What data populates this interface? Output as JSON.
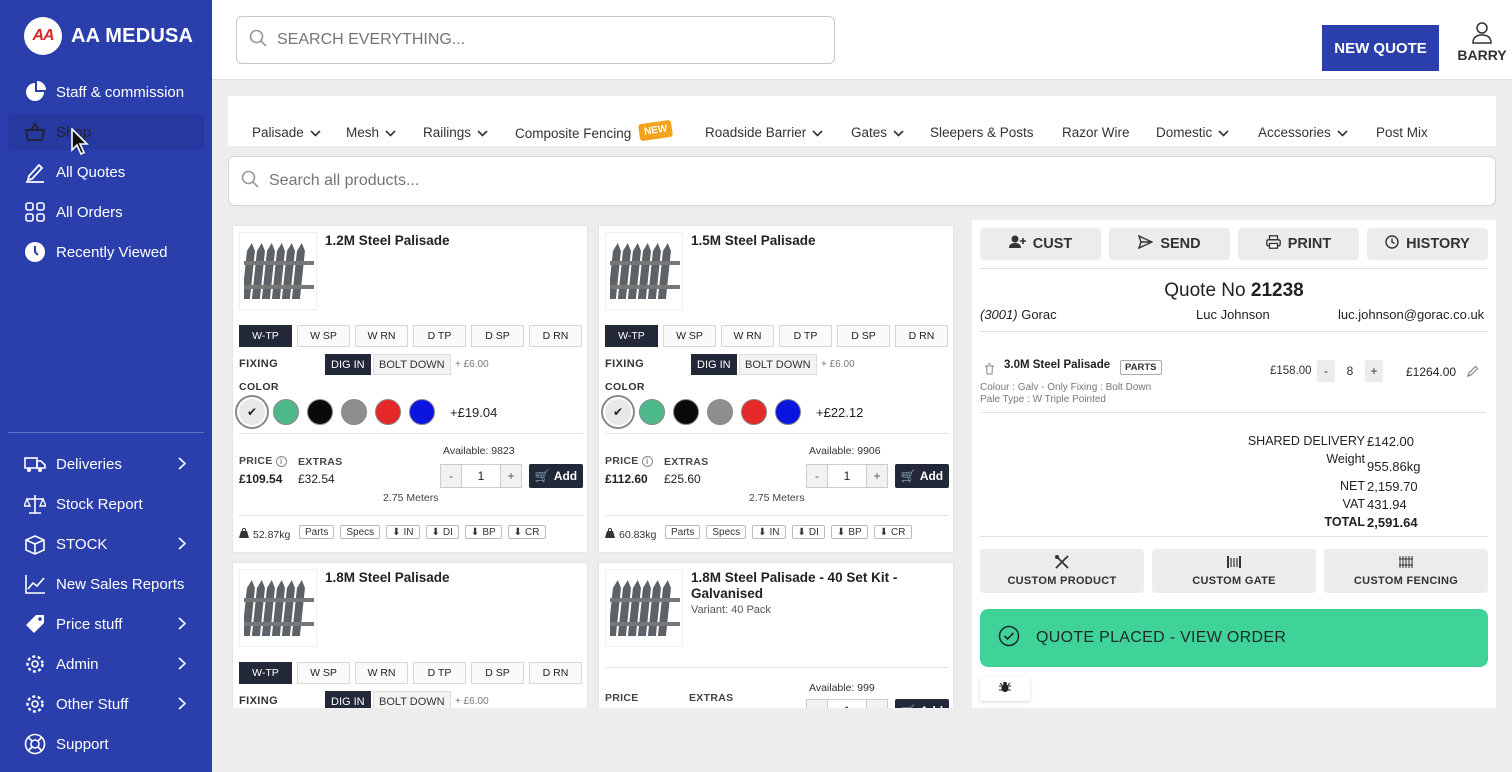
{
  "brand": {
    "logo_text": "AA",
    "name": "AA MEDUSA"
  },
  "sidebar": {
    "items_top": [
      {
        "label": "Staff & commission",
        "icon": "pie-chart-icon"
      },
      {
        "label": "Shop",
        "icon": "basket-icon"
      },
      {
        "label": "All Quotes",
        "icon": "edit-icon"
      },
      {
        "label": "All Orders",
        "icon": "grid-icon"
      },
      {
        "label": "Recently Viewed",
        "icon": "clock-icon"
      }
    ],
    "items_bottom": [
      {
        "label": "Deliveries",
        "icon": "truck-icon",
        "submenu": true
      },
      {
        "label": "Stock Report",
        "icon": "scales-icon",
        "submenu": false
      },
      {
        "label": "STOCK",
        "icon": "box-icon",
        "submenu": true
      },
      {
        "label": "New Sales Reports",
        "icon": "line-chart-icon",
        "submenu": false
      },
      {
        "label": "Price stuff",
        "icon": "tag-icon",
        "submenu": true
      },
      {
        "label": "Admin",
        "icon": "gear-icon",
        "submenu": true
      },
      {
        "label": "Other Stuff",
        "icon": "gear-icon",
        "submenu": true
      },
      {
        "label": "Support",
        "icon": "lifebuoy-icon",
        "submenu": false
      }
    ]
  },
  "header": {
    "search_placeholder": "SEARCH EVERYTHING...",
    "new_quote_label": "NEW QUOTE",
    "user_name": "BARRY"
  },
  "categories": [
    {
      "label": "Palisade",
      "dropdown": true
    },
    {
      "label": "Mesh",
      "dropdown": true
    },
    {
      "label": "Railings",
      "dropdown": true
    },
    {
      "label": "Composite Fencing",
      "dropdown": false,
      "badge": "NEW"
    },
    {
      "label": "Roadside Barrier",
      "dropdown": true
    },
    {
      "label": "Gates",
      "dropdown": true
    },
    {
      "label": "Sleepers & Posts",
      "dropdown": false
    },
    {
      "label": "Razor Wire",
      "dropdown": false
    },
    {
      "label": "Domestic",
      "dropdown": true
    },
    {
      "label": "Accessories",
      "dropdown": true
    },
    {
      "label": "Post Mix",
      "dropdown": false
    }
  ],
  "product_search_placeholder": "Search all products...",
  "variant_labels": [
    "W-TP",
    "W SP",
    "W RN",
    "D TP",
    "D SP",
    "D RN"
  ],
  "card_labels": {
    "fixing": "FIXING",
    "dig_in": "DIG IN",
    "bolt_down": "BOLT DOWN",
    "bolt_extra": "+ £6.00",
    "color": "COLOR",
    "price": "PRICE",
    "extras": "EXTRAS",
    "add": "Add",
    "meters": "2.75 Meters",
    "docs": [
      "Parts",
      "Specs",
      "IN",
      "DI",
      "BP",
      "CR"
    ]
  },
  "swatch_colors": [
    "#e8e8e8",
    "#4db88a",
    "#0a0a0a",
    "#8e8e8e",
    "#e52929",
    "#0a15e0"
  ],
  "products": [
    {
      "title": "1.2M Steel Palisade",
      "color_extra": "+£19.04",
      "price": "£109.54",
      "extras": "£32.54",
      "available": "Available: 9823",
      "qty": "1",
      "weight": "52.87kg"
    },
    {
      "title": "1.5M Steel Palisade",
      "color_extra": "+£22.12",
      "price": "£112.60",
      "extras": "£25.60",
      "available": "Available: 9906",
      "qty": "1",
      "weight": "60.83kg"
    },
    {
      "title": "1.8M Steel Palisade"
    },
    {
      "title": "1.8M Steel Palisade - 40 Set Kit - Galvanised",
      "variant": "Variant: 40 Pack",
      "available": "Available: 999"
    }
  ],
  "quote": {
    "buttons": [
      {
        "label": "CUST",
        "icon": "user-plus-icon"
      },
      {
        "label": "SEND",
        "icon": "send-icon"
      },
      {
        "label": "PRINT",
        "icon": "printer-icon"
      },
      {
        "label": "HISTORY",
        "icon": "clock-icon"
      }
    ],
    "quote_no_label": "Quote No",
    "quote_no": "21238",
    "customer_code": "(3001)",
    "customer_name": "Gorac",
    "contact": "Luc Johnson",
    "email": "luc.johnson@gorac.co.uk",
    "line": {
      "name": "3.0M Steel Palisade",
      "badge": "PARTS",
      "unit_price": "£158.00",
      "qty": "8",
      "total": "£1264.00",
      "meta1": "Colour : Galv - Only   Fixing : Bolt Down",
      "meta2": "Pale Type : W Triple Pointed"
    },
    "totals": {
      "shared_delivery_label": "SHARED DELIVERY",
      "shared_delivery": "£142.00",
      "weight_label": "Weight",
      "weight": "955.86kg",
      "net_label": "NET",
      "net": "2,159.70",
      "vat_label": "VAT",
      "vat": "431.94",
      "total_label": "TOTAL",
      "total": "2,591.64"
    },
    "custom_buttons": [
      "CUSTOM PRODUCT",
      "CUSTOM GATE",
      "CUSTOM FENCING"
    ],
    "placed_label": "QUOTE PLACED - VIEW ORDER"
  }
}
